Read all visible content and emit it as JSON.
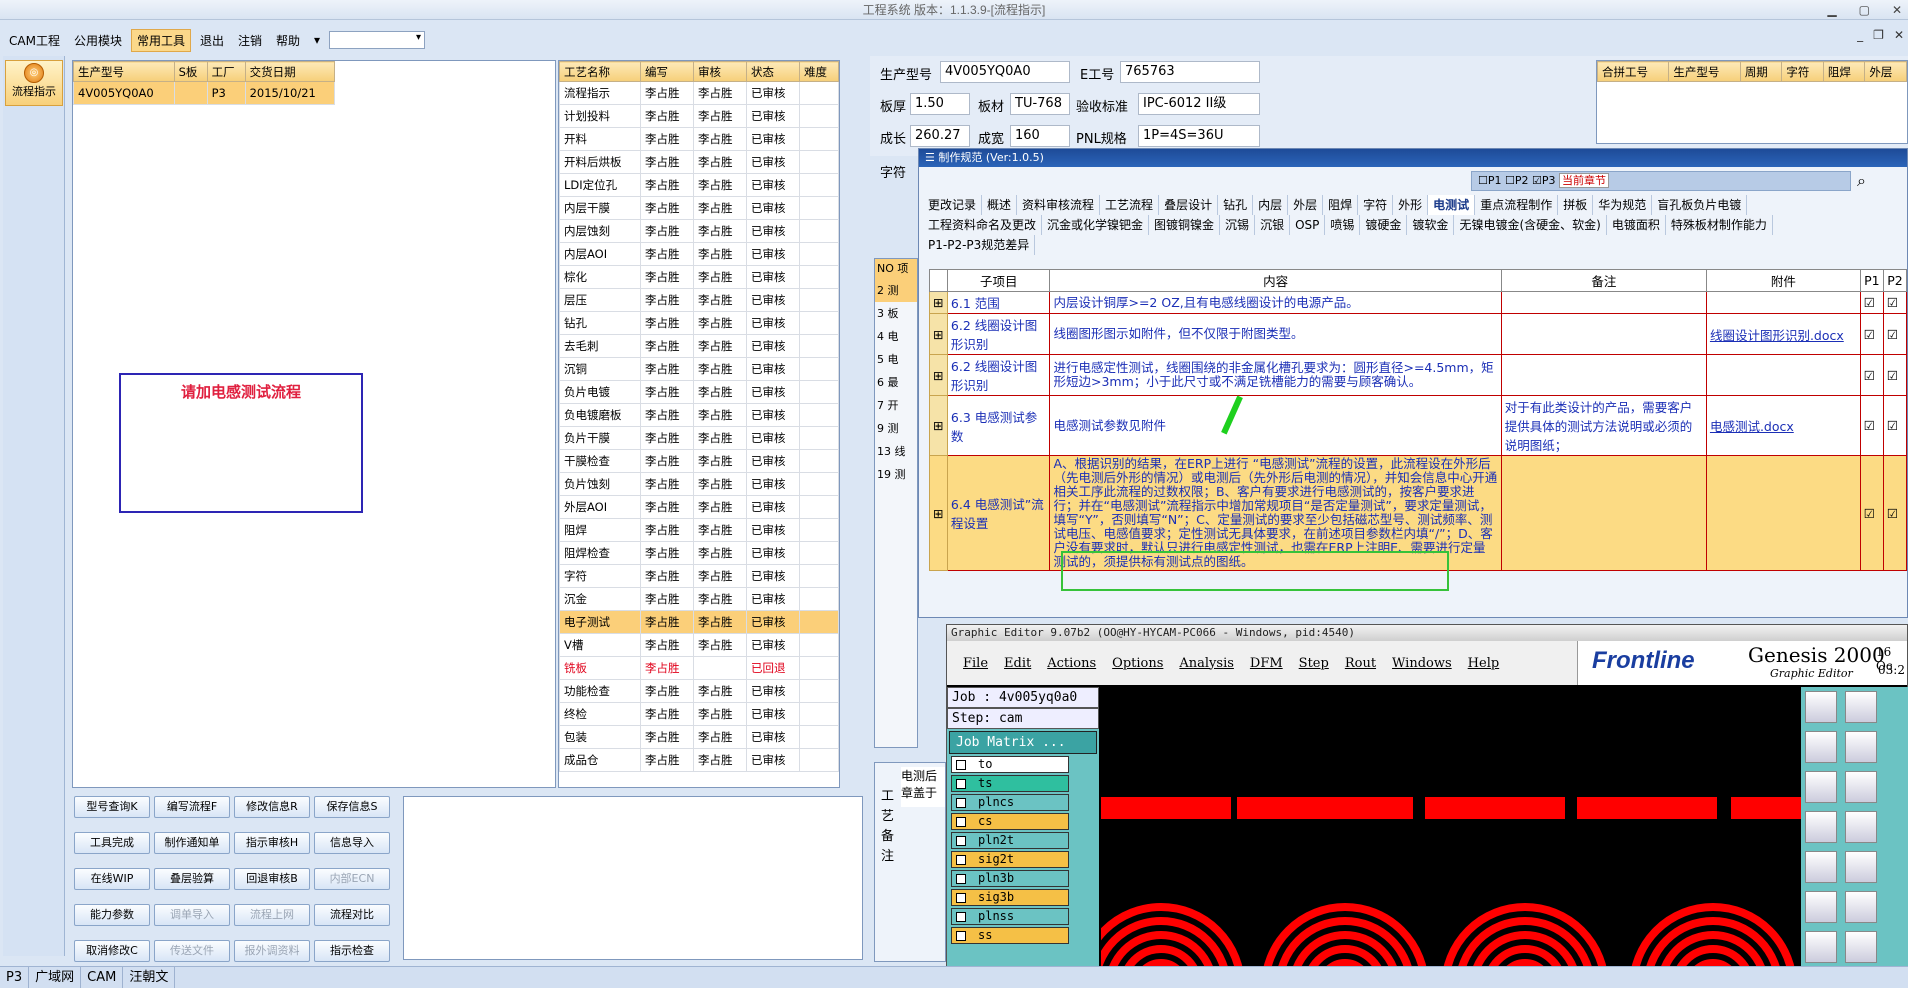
{
  "title": "工程系统 版本：1.1.3.9-[流程指示]",
  "menu": {
    "items": [
      "CAM工程",
      "公用模块",
      "常用工具",
      "退出",
      "注销",
      "帮助"
    ],
    "active": "常用工具"
  },
  "nav": {
    "label": "流程指示"
  },
  "job_table": {
    "headers": [
      "生产型号",
      "S板",
      "工厂",
      "交货日期"
    ],
    "row": [
      "4V005YQ0A0",
      "",
      "P3",
      "2015/10/21"
    ]
  },
  "notice": "请加电感测试流程",
  "process_table": {
    "headers": [
      "工艺名称",
      "编写",
      "审核",
      "状态",
      "难度"
    ],
    "rows": [
      [
        "流程指示",
        "李占胜",
        "李占胜",
        "已审核",
        ""
      ],
      [
        "计划投料",
        "李占胜",
        "李占胜",
        "已审核",
        ""
      ],
      [
        "开料",
        "李占胜",
        "李占胜",
        "已审核",
        ""
      ],
      [
        "开料后烘板",
        "李占胜",
        "李占胜",
        "已审核",
        ""
      ],
      [
        "LDI定位孔",
        "李占胜",
        "李占胜",
        "已审核",
        ""
      ],
      [
        "内层干膜",
        "李占胜",
        "李占胜",
        "已审核",
        ""
      ],
      [
        "内层蚀刻",
        "李占胜",
        "李占胜",
        "已审核",
        ""
      ],
      [
        "内层AOI",
        "李占胜",
        "李占胜",
        "已审核",
        ""
      ],
      [
        "棕化",
        "李占胜",
        "李占胜",
        "已审核",
        ""
      ],
      [
        "层压",
        "李占胜",
        "李占胜",
        "已审核",
        ""
      ],
      [
        "钻孔",
        "李占胜",
        "李占胜",
        "已审核",
        ""
      ],
      [
        "去毛刺",
        "李占胜",
        "李占胜",
        "已审核",
        ""
      ],
      [
        "沉铜",
        "李占胜",
        "李占胜",
        "已审核",
        ""
      ],
      [
        "负片电镀",
        "李占胜",
        "李占胜",
        "已审核",
        ""
      ],
      [
        "负电镀磨板",
        "李占胜",
        "李占胜",
        "已审核",
        ""
      ],
      [
        "负片干膜",
        "李占胜",
        "李占胜",
        "已审核",
        ""
      ],
      [
        "干膜检查",
        "李占胜",
        "李占胜",
        "已审核",
        ""
      ],
      [
        "负片蚀刻",
        "李占胜",
        "李占胜",
        "已审核",
        ""
      ],
      [
        "外层AOI",
        "李占胜",
        "李占胜",
        "已审核",
        ""
      ],
      [
        "阻焊",
        "李占胜",
        "李占胜",
        "已审核",
        ""
      ],
      [
        "阻焊检查",
        "李占胜",
        "李占胜",
        "已审核",
        ""
      ],
      [
        "字符",
        "李占胜",
        "李占胜",
        "已审核",
        ""
      ],
      [
        "沉金",
        "李占胜",
        "李占胜",
        "已审核",
        ""
      ],
      [
        "电子测试",
        "李占胜",
        "李占胜",
        "已审核",
        ""
      ],
      [
        "V槽",
        "李占胜",
        "李占胜",
        "已审核",
        ""
      ],
      [
        "铣板",
        "李占胜",
        "",
        "已回退",
        ""
      ],
      [
        "功能检查",
        "李占胜",
        "李占胜",
        "已审核",
        ""
      ],
      [
        "终检",
        "李占胜",
        "李占胜",
        "已审核",
        ""
      ],
      [
        "包装",
        "李占胜",
        "李占胜",
        "已审核",
        ""
      ],
      [
        "成品仓",
        "李占胜",
        "李占胜",
        "已审核",
        ""
      ]
    ]
  },
  "buttons": [
    [
      "型号查询K",
      "编写流程F",
      "修改信息R",
      "保存信息S"
    ],
    [
      "工具完成",
      "制作通知单",
      "指示审核H",
      "信息导入"
    ],
    [
      "在线WIP",
      "叠层验算",
      "回退审核B",
      "内部ECN"
    ],
    [
      "能力参数",
      "调单导入",
      "流程上网",
      "流程对比"
    ],
    [
      "取消修改C",
      "传送文件",
      "报外调资料",
      "指示检查"
    ]
  ],
  "info": {
    "prod_label": "生产型号",
    "prod": "4V005YQ0A0",
    "e_label": "E工号",
    "e": "765763",
    "thick_label": "板厚",
    "thick": "1.50",
    "mat_label": "板材",
    "mat": "TU-768",
    "std_label": "验收标准",
    "std": "IPC-6012 II级",
    "len_label": "成长",
    "len": "260.27",
    "wid_label": "成宽",
    "wid": "160",
    "pnl_label": "PNL规格",
    "pnl": "1P=4S=36U",
    "char_label": "字符"
  },
  "right_table": {
    "headers": [
      "合拼工号",
      "生产型号",
      "周期",
      "字符",
      "阻焊",
      "外层"
    ]
  },
  "side_list": {
    "header": [
      "NO",
      "项"
    ],
    "rows": [
      [
        "2",
        "测"
      ],
      [
        "3",
        "板"
      ],
      [
        "4",
        "电"
      ],
      [
        "5",
        "电"
      ],
      [
        "6",
        "最"
      ],
      [
        "7",
        "开"
      ],
      [
        "9",
        "测"
      ],
      [
        "13",
        "线"
      ],
      [
        "19",
        "测"
      ]
    ]
  },
  "remark": {
    "label": "工艺备注",
    "text": "电测后\n章盖于"
  },
  "spec": {
    "title": "制作规范  (Ver:1.0.5)",
    "p_options": [
      "P1",
      "P2",
      "P3"
    ],
    "section": "当前章节",
    "tabs1": [
      "更改记录",
      "概述",
      "资料审核流程",
      "工艺流程",
      "叠层设计",
      "钻孔",
      "内层",
      "外层",
      "阻焊",
      "字符",
      "外形",
      "电测试",
      "重点流程制作",
      "拼板",
      "华为规范",
      "盲孔板负片电镀"
    ],
    "tabs2": [
      "工程资料命名及更改",
      "沉金或化学镍钯金",
      "图镀铜镍金",
      "沉锡",
      "沉银",
      "OSP",
      "喷锡",
      "镀硬金",
      "镀软金",
      "无镍电镀金(含硬金、软金)",
      "电镀面积",
      "特殊板材制作能力"
    ],
    "tabs3": [
      "P1-P2-P3规范差异"
    ],
    "active_tab": "电测试",
    "headers": [
      "子项目",
      "内容",
      "备注",
      "附件",
      "P1",
      "P2"
    ],
    "rows": [
      {
        "item": "6.1 范围",
        "content": "内层设计铜厚>=2 OZ,且有电感线圈设计的电源产品。",
        "remark": "",
        "attach": ""
      },
      {
        "item": "6.2 线圈设计图形识别",
        "content": "线圈图形图示如附件，但不仅限于附图类型。",
        "remark": "",
        "attach": "线圈设计图形识别.docx"
      },
      {
        "item": "6.2 线圈设计图形识别",
        "content": "进行电感定性测试，线圈围绕的非金属化槽孔要求为：圆形直径>=4.5mm，矩形短边>3mm；小于此尺寸或不满足铣槽能力的需要与顾客确认。",
        "remark": "",
        "attach": ""
      },
      {
        "item": "6.3 电感测试参数",
        "content": "电感测试参数见附件",
        "remark": "对于有此类设计的产品，需要客户提供具体的测试方法说明或必须的说明图纸；",
        "attach": "电感测试.docx"
      },
      {
        "item": "6.4 电感测试”流程设置",
        "content": "A、根据识别的结果，在ERP上进行 “电感测试”流程的设置，此流程设在外形后（先电测后外形的情况）或电测后（先外形后电测的情况），并知会信息中心开通相关工序此流程的过数权限；B、客户有要求进行电感测试的，按客户要求进行；并在“电感测试”流程指示中增加常规项目“是否定量测试”，要求定量测试，填写“Y”，否则填写“N”；C、定量测试的要求至少包括磁芯型号、测试频率、测试电压、电感值要求；定性测试无具体要求，在前述项目参数栏内填“/”；D、客户没有要求时，默认只进行电感定性测试，也需在ERP上注明E、需要进行定量测试的，须提供标有测试点的图纸。",
        "remark": "",
        "attach": ""
      }
    ]
  },
  "editor": {
    "title": "Graphic Editor 9.07b2 (OO@HY-HYCAM-PC066 - Windows, pid:4540)",
    "menu": [
      "File",
      "Edit",
      "Actions",
      "Options",
      "Analysis",
      "DFM",
      "Step",
      "Rout",
      "Windows",
      "Help"
    ],
    "brand": "Frontline",
    "product": "Genesis 2000",
    "subtitle": "Graphic Editor",
    "date": "16 Oc",
    "time": "03:2",
    "job": "Job : 4v005yq0a0",
    "step": "Step: cam",
    "matrix": "Job Matrix ...",
    "layers": [
      {
        "name": "to",
        "color": "#ffffff"
      },
      {
        "name": "ts",
        "color": "#2fbf9f"
      },
      {
        "name": "plncs",
        "color": "#6bc3c3"
      },
      {
        "name": "cs",
        "color": "#f5c046"
      },
      {
        "name": "pln2t",
        "color": "#6bc3c3"
      },
      {
        "name": "sig2t",
        "color": "#f5c046"
      },
      {
        "name": "pln3b",
        "color": "#6bc3c3"
      },
      {
        "name": "sig3b",
        "color": "#f5c046"
      },
      {
        "name": "plnss",
        "color": "#6bc3c3"
      },
      {
        "name": "ss",
        "color": "#f5c046"
      }
    ]
  },
  "status": {
    "p": "P3",
    "items": [
      "广域网",
      "CAM",
      "汪朝文"
    ]
  },
  "colors": {
    "accent": "#fbcf79",
    "red": "#e0001a",
    "pcb": "#ff0000",
    "editor_bg": "#000000"
  }
}
